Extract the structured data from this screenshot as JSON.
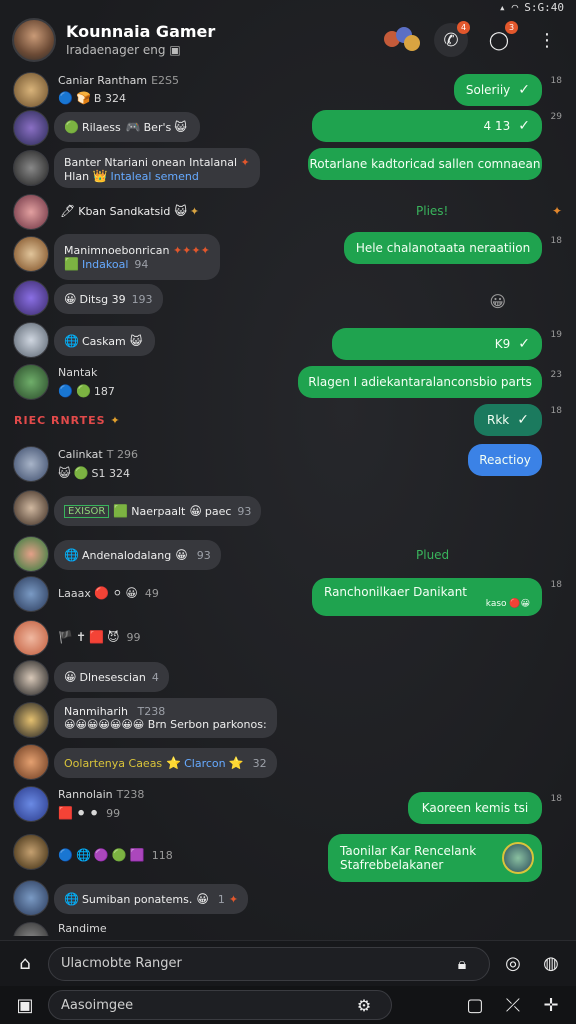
{
  "status": {
    "time": "S:G:40",
    "wifi_icon": "wifi-icon",
    "signal_icon": "signal-icon"
  },
  "header": {
    "title": "Kounnaia Gamer",
    "subtitle": "Iradaenager eng",
    "badge_calls": "4",
    "badge_messages": "3"
  },
  "messages": [
    {
      "kind": "in",
      "sender": "Caniar Rantham",
      "time": "E2S5",
      "meta2": "B 324",
      "text": ""
    },
    {
      "kind": "out",
      "text": "Soleriiy",
      "side_time": "18"
    },
    {
      "kind": "in",
      "text": "Rilaess",
      "extra": "Ber's"
    },
    {
      "kind": "out",
      "text": "4 13",
      "side_time": "29"
    },
    {
      "kind": "in",
      "sender": "Banter Ntariani onean Intalanal",
      "text": "Hlan",
      "extra": "Intaleal semend"
    },
    {
      "kind": "out",
      "text": "Rotarlane kadtoricad sallen comnaean",
      "side_time": ""
    },
    {
      "kind": "in",
      "text": "Kban Sandkatsid",
      "side_label": "Plies!"
    },
    {
      "kind": "in",
      "sender": "Manimnoebonrican",
      "text": "Indakoal",
      "count": "94"
    },
    {
      "kind": "out",
      "text": "Hele chalanotaata neraatiion",
      "side_time": "18"
    },
    {
      "kind": "in",
      "text": "Ditsg 39",
      "time": "193"
    },
    {
      "kind": "in",
      "text": "Caskam"
    },
    {
      "kind": "out",
      "text": "K9",
      "side_time": "19"
    },
    {
      "kind": "in",
      "sender": "Nantak",
      "time": "187"
    },
    {
      "kind": "out",
      "text": "Rlagen I adiekantaralanconsbio parts",
      "side_time": "23"
    },
    {
      "kind": "in",
      "redline": "RIEC RNRTES"
    },
    {
      "kind": "out",
      "text": "Rkk",
      "side_time": "18"
    },
    {
      "kind": "in",
      "sender": "Calinkat",
      "time": "T 296",
      "meta2": "S1 324"
    },
    {
      "kind": "out",
      "text": "Reactioy"
    },
    {
      "kind": "in",
      "text": "Naerpaalt",
      "extra": "paec",
      "count": "93",
      "tag": "EXISOR"
    },
    {
      "kind": "in",
      "text": "Andenalodalang",
      "count": "93",
      "side_label": "Plued"
    },
    {
      "kind": "in",
      "sender": "Laaax",
      "count": "49"
    },
    {
      "kind": "out",
      "text": "Ranchonilkaer Danikant",
      "side_time": "18",
      "sub": "kaso"
    },
    {
      "kind": "in",
      "count": "99"
    },
    {
      "kind": "in",
      "text": "Dlnesescian",
      "count": "4"
    },
    {
      "kind": "in",
      "sender": "Nanmiharih",
      "time": "T238",
      "text": "Brn Serbon parkonos:"
    },
    {
      "kind": "in",
      "text": "Oolartenya Caeas",
      "extra": "Clarcon",
      "count": "32"
    },
    {
      "kind": "in",
      "sender": "Rannolain",
      "time": "T238",
      "count": "99"
    },
    {
      "kind": "out",
      "text": "Kaoreen kemis tsi",
      "side_time": "18"
    },
    {
      "kind": "in",
      "count": "118"
    },
    {
      "kind": "out",
      "text": "Taonilar Kar Rencelank Stafrebbelakaner",
      "side_time": ""
    },
    {
      "kind": "in",
      "text": "Sumiban ponatems.",
      "count": "1"
    },
    {
      "kind": "in",
      "sender": "Randime"
    }
  ],
  "composer": {
    "placeholder_primary": "Ulacmobte Ranger",
    "placeholder_secondary": "Aasoimgee"
  },
  "colors": {
    "out_bubble": "#1fa34f",
    "in_bubble": "#37383d",
    "accent_blue": "#3b82e6",
    "badge": "#e2572c"
  }
}
